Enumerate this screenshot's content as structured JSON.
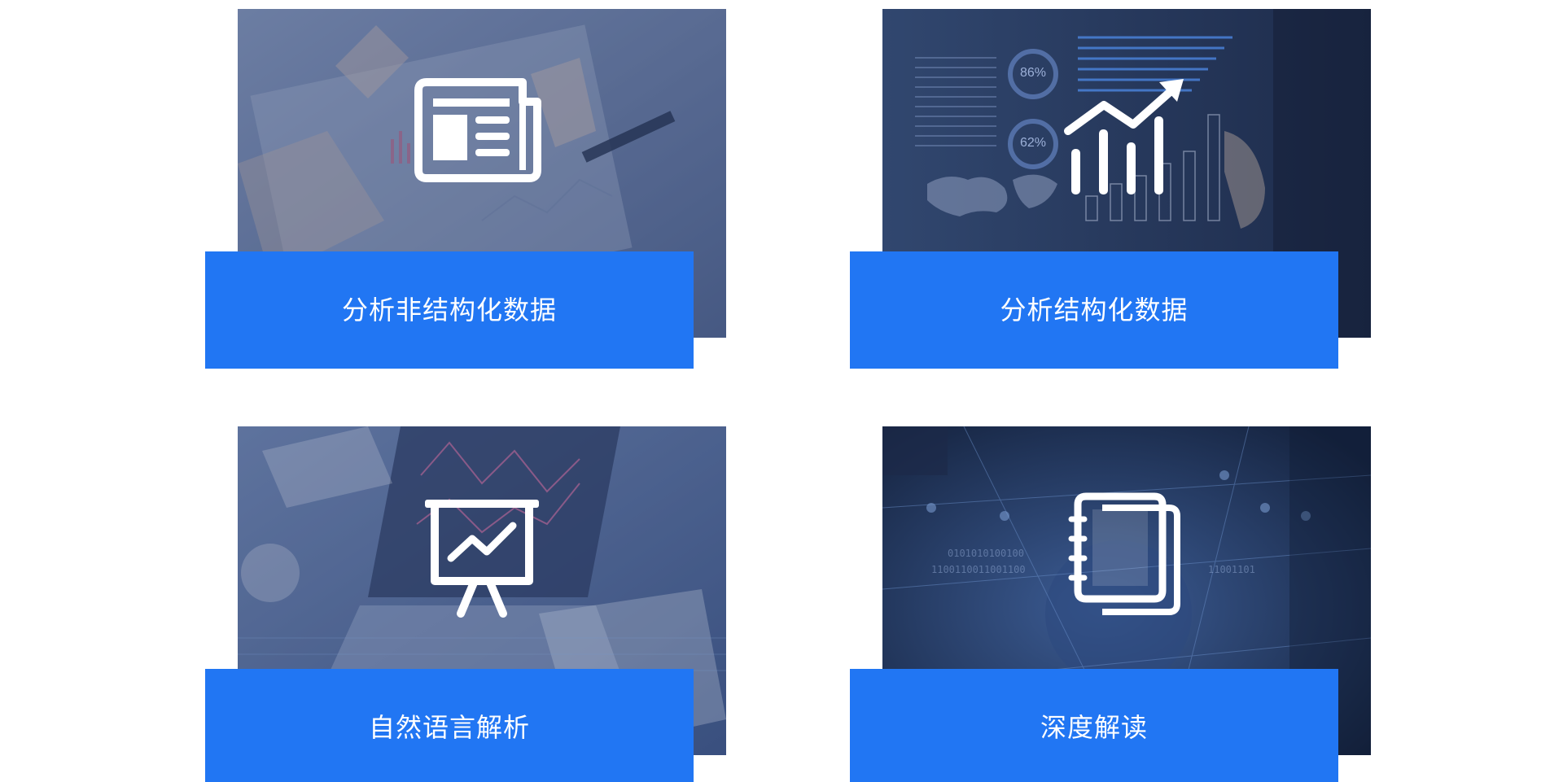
{
  "cards": [
    {
      "label": "分析非结构化数据",
      "icon": "newspaper-icon"
    },
    {
      "label": "分析结构化数据",
      "icon": "bar-chart-growth-icon",
      "image_text": {
        "gauge_1": "86%",
        "gauge_2": "62%"
      }
    },
    {
      "label": "自然语言解析",
      "icon": "presentation-chart-icon"
    },
    {
      "label": "深度解读",
      "icon": "notebook-icon"
    }
  ],
  "colors": {
    "accent": "#2176f3",
    "image_overlay": "#2b3f6e",
    "icon": "#ffffff"
  }
}
